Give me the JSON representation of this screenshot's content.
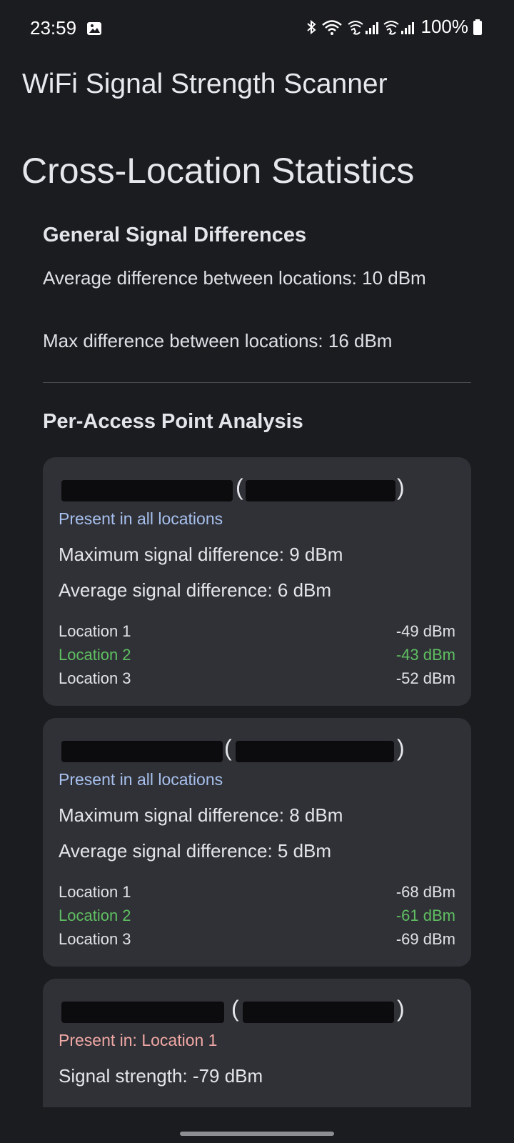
{
  "status_bar": {
    "time": "23:59",
    "battery": "100%",
    "icons": [
      "gallery-icon",
      "bluetooth-icon",
      "wifi-icon",
      "wifi-calling-sim1-icon",
      "wifi-calling-sim2-icon",
      "battery-icon"
    ]
  },
  "app": {
    "title": "WiFi Signal Strength Scanner"
  },
  "page": {
    "title": "Cross-Location Statistics"
  },
  "general": {
    "heading": "General Signal Differences",
    "average_text": "Average difference between locations: 10 dBm",
    "max_text": "Max difference between locations: 16 dBm"
  },
  "per_ap": {
    "heading": "Per-Access Point Analysis",
    "cards": [
      {
        "presence": "Present in all locations",
        "max_diff": "Maximum signal difference: 9 dBm",
        "avg_diff": "Average signal difference: 6 dBm",
        "locations": [
          {
            "name": "Location 1",
            "value": "-49 dBm"
          },
          {
            "name": "Location 2",
            "value": "-43 dBm"
          },
          {
            "name": "Location 3",
            "value": "-52 dBm"
          }
        ]
      },
      {
        "presence": "Present in all locations",
        "max_diff": "Maximum signal difference: 8 dBm",
        "avg_diff": "Average signal difference: 5 dBm",
        "locations": [
          {
            "name": "Location 1",
            "value": "-68 dBm"
          },
          {
            "name": "Location 2",
            "value": "-61 dBm"
          },
          {
            "name": "Location 3",
            "value": "-69 dBm"
          }
        ]
      },
      {
        "presence": "Present in: Location 1",
        "signal": "Signal strength: -79 dBm"
      }
    ]
  },
  "colors": {
    "background": "#1b1c20",
    "card": "#303136",
    "presence_all": "#a7c0ee",
    "presence_partial": "#f0a8a5",
    "best_location": "#5fbf62"
  }
}
